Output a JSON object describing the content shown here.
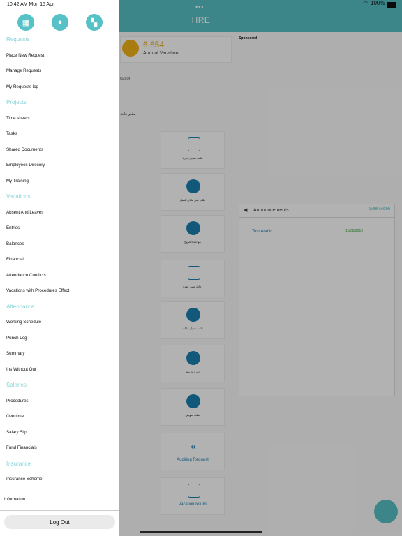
{
  "status_bar": {
    "time": "10:42 AM  Mon 15 Apr",
    "battery": "100%"
  },
  "background": {
    "nav_title": "HRE",
    "vacation": {
      "value": "6.654",
      "label": "Annual Vacation"
    },
    "sponsored": "Sponsored",
    "partial_labels": [
      "cation",
      "مقترحات"
    ],
    "tiles": [
      {
        "label": "طلب تعديل إجازة"
      },
      {
        "label": "طلب تغير مكان العمل"
      },
      {
        "label": "مواعيد الخروج"
      },
      {
        "label": "إعادة تعيين عهدة"
      },
      {
        "label": "طلب تعديل بيانات"
      },
      {
        "label": "دورة تدريبية"
      },
      {
        "label": "طلب تعويض"
      },
      {
        "label": "Auditing Request"
      },
      {
        "label": "vacation return"
      }
    ],
    "announcements": {
      "title": "Announcements",
      "see_more": "See More",
      "item": "Test Arabic",
      "date": "15/08/2019"
    },
    "colors": {
      "primary": "#56c1c6",
      "accent": "#1a7fb0",
      "gold": "#e6a918"
    }
  },
  "drawer": {
    "top_icons": [
      "dashboard-icon",
      "profile-icon",
      "org-chart-icon"
    ],
    "menu": [
      {
        "type": "section",
        "label": "Requests"
      },
      {
        "type": "item",
        "label": "Place New Request"
      },
      {
        "type": "item",
        "label": "Manage Requests"
      },
      {
        "type": "item",
        "label": "My Requests log"
      },
      {
        "type": "section",
        "label": "Projects"
      },
      {
        "type": "item",
        "label": "Time sheets"
      },
      {
        "type": "item",
        "label": "Tasks"
      },
      {
        "type": "item",
        "label": "Shared Documents"
      },
      {
        "type": "item",
        "label": "Employees Direcory"
      },
      {
        "type": "item",
        "label": "My Training"
      },
      {
        "type": "section",
        "label": "Vacations"
      },
      {
        "type": "item",
        "label": "Absent And Leaves"
      },
      {
        "type": "item",
        "label": "Entries"
      },
      {
        "type": "item",
        "label": "Balances"
      },
      {
        "type": "item",
        "label": "Financial"
      },
      {
        "type": "item",
        "label": "Attendance Conflicts"
      },
      {
        "type": "item",
        "label": "Vacations with Procedures Effect"
      },
      {
        "type": "section",
        "label": "Attendance"
      },
      {
        "type": "item",
        "label": "Working Schedule"
      },
      {
        "type": "item",
        "label": "Punch Log"
      },
      {
        "type": "item",
        "label": "Summary"
      },
      {
        "type": "item",
        "label": "Ins Without Out"
      },
      {
        "type": "section",
        "label": "Salaries"
      },
      {
        "type": "item",
        "label": "Procedures"
      },
      {
        "type": "item",
        "label": "Overtime"
      },
      {
        "type": "item",
        "label": "Salary Slip"
      },
      {
        "type": "item",
        "label": "Fund Financials"
      },
      {
        "type": "section",
        "label": "Insurance"
      },
      {
        "type": "item",
        "label": "Insurance Scheme"
      }
    ],
    "information": "Information",
    "logout": "Log Out"
  }
}
